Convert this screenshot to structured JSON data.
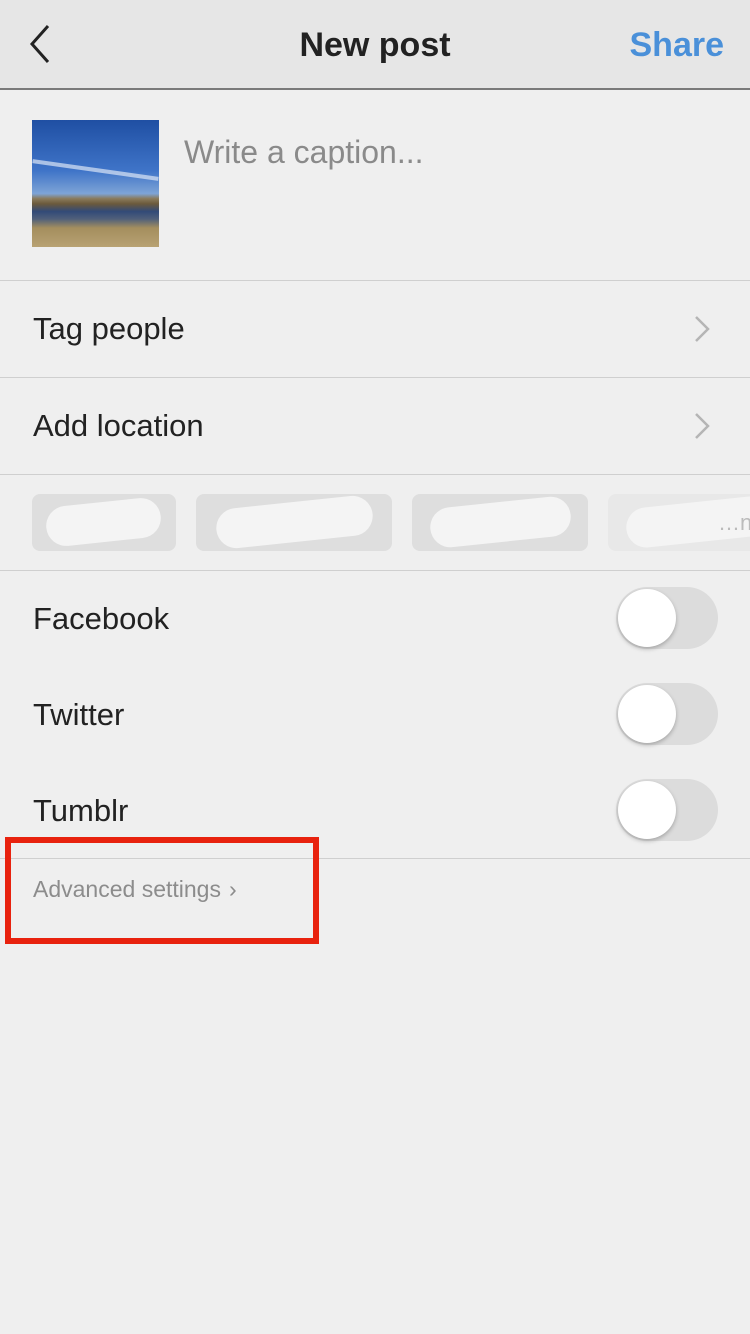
{
  "header": {
    "title": "New post",
    "share_label": "Share",
    "back_icon": "chevron-left-icon"
  },
  "caption": {
    "placeholder": "Write a caption...",
    "value": ""
  },
  "rows": {
    "tag_people": {
      "label": "Tag people"
    },
    "add_location": {
      "label": "Add location"
    }
  },
  "location_suggestions": [
    "(redacted)",
    "(redacted)",
    "(redacted)",
    "…nd"
  ],
  "share_to": [
    {
      "label": "Facebook",
      "enabled": false
    },
    {
      "label": "Twitter",
      "enabled": false
    },
    {
      "label": "Tumblr",
      "enabled": false
    }
  ],
  "advanced": {
    "label": "Advanced settings",
    "chevron": "›"
  },
  "colors": {
    "accent": "#4a90d9",
    "highlight": "#e8220e",
    "background": "#efefef"
  }
}
